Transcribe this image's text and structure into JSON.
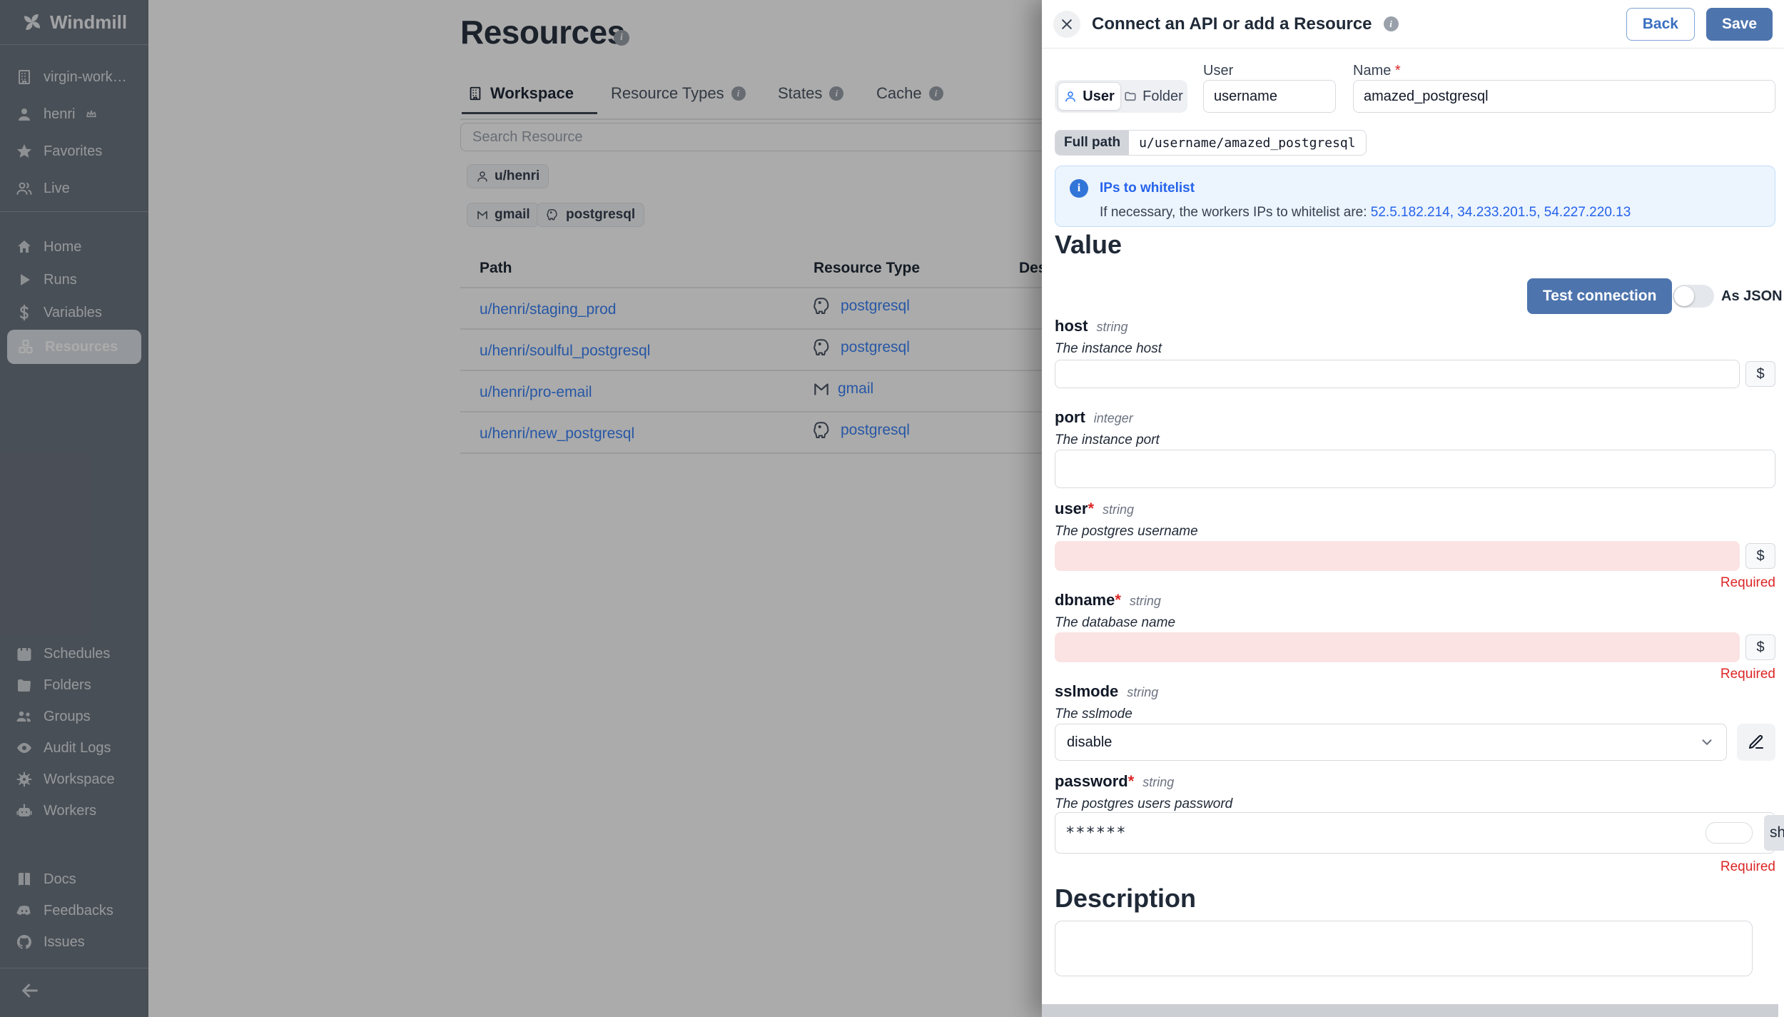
{
  "sidebar": {
    "brand": "Windmill",
    "workspace_item": "virgin-worksp...",
    "user_item": "henri",
    "favorites_item": "Favorites",
    "live_item": "Live",
    "home": "Home",
    "runs": "Runs",
    "variables": "Variables",
    "resources": "Resources",
    "schedules": "Schedules",
    "folders": "Folders",
    "groups": "Groups",
    "audit_logs": "Audit Logs",
    "workspace_settings": "Workspace",
    "workers": "Workers",
    "docs": "Docs",
    "feedbacks": "Feedbacks",
    "issues": "Issues"
  },
  "main": {
    "title": "Resources",
    "tabs": {
      "workspace": "Workspace",
      "resource_types": "Resource Types",
      "states": "States",
      "cache": "Cache"
    },
    "search_placeholder": "Search Resource",
    "owner_chip": "u/henri",
    "chip_gmail": "gmail",
    "chip_postgresql": "postgresql",
    "table": {
      "col_path": "Path",
      "col_type": "Resource Type",
      "col_desc": "Description",
      "rows": [
        {
          "path": "u/henri/staging_prod",
          "type": "postgresql"
        },
        {
          "path": "u/henri/soulful_postgresql",
          "type": "postgresql"
        },
        {
          "path": "u/henri/pro-email",
          "type": "gmail"
        },
        {
          "path": "u/henri/new_postgresql",
          "type": "postgresql"
        }
      ]
    }
  },
  "drawer": {
    "title": "Connect an API or add a Resource",
    "back_label": "Back",
    "save_label": "Save",
    "user_label": "User",
    "name_label": "Name",
    "required_star": "*",
    "segment_user": "User",
    "segment_folder": "Folder",
    "username_value": "username",
    "name_value": "amazed_postgresql",
    "full_path_label": "Full path",
    "full_path_value": "u/username/amazed_postgresql",
    "alert": {
      "title": "IPs to whitelist",
      "text": "If necessary, the workers IPs to whitelist are: ",
      "ips": "52.5.182.214, 34.233.201.5, 54.227.220.13"
    },
    "value_heading": "Value",
    "test_connection_label": "Test connection",
    "as_json_label": "As JSON",
    "dollar": "$",
    "required_label": "Required",
    "fields": {
      "host": {
        "name": "host",
        "type": "string",
        "desc": "The instance host"
      },
      "port": {
        "name": "port",
        "type": "integer",
        "desc": "The instance port"
      },
      "user": {
        "name": "user",
        "type": "string",
        "desc": "The postgres username"
      },
      "dbname": {
        "name": "dbname",
        "type": "string",
        "desc": "The database name"
      },
      "sslmode": {
        "name": "sslmode",
        "type": "string",
        "desc": "The sslmode",
        "value": "disable"
      },
      "password": {
        "name": "password",
        "type": "string",
        "desc": "The postgres users password",
        "value": "******",
        "clipped_button": "sh"
      }
    },
    "description_heading": "Description"
  },
  "colors": {
    "accent_blue": "#3b82f6",
    "button_blue": "#4d74ad",
    "sidebar_bg": "#6e7681",
    "required_red": "#dc2626",
    "alert_bg": "#ecf4fd"
  }
}
